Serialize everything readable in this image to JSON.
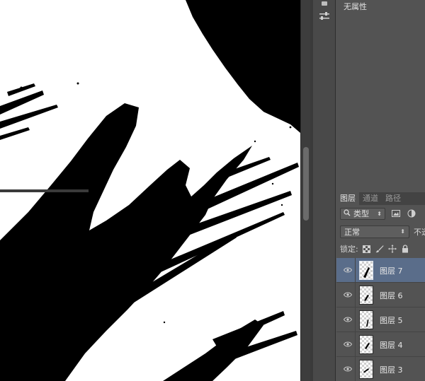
{
  "properties": {
    "empty_text": "无属性"
  },
  "layers_panel": {
    "tabs": [
      {
        "label": "图层",
        "active": true
      },
      {
        "label": "通道",
        "active": false
      },
      {
        "label": "路径",
        "active": false
      }
    ],
    "filter": {
      "label": "类型",
      "icon": "search-icon"
    },
    "blend_mode": "正常",
    "opacity_label": "不透",
    "lock_label": "锁定:",
    "layers": [
      {
        "name": "图层 7",
        "selected": true
      },
      {
        "name": "图层 6",
        "selected": false
      },
      {
        "name": "图层 5",
        "selected": false
      },
      {
        "name": "图层 4",
        "selected": false
      },
      {
        "name": "图层 3",
        "selected": false
      }
    ]
  },
  "colors": {
    "panel_bg": "#535353",
    "selected_row": "#5a6d8a",
    "canvas_bg": "#ffffff",
    "ink": "#000000"
  }
}
